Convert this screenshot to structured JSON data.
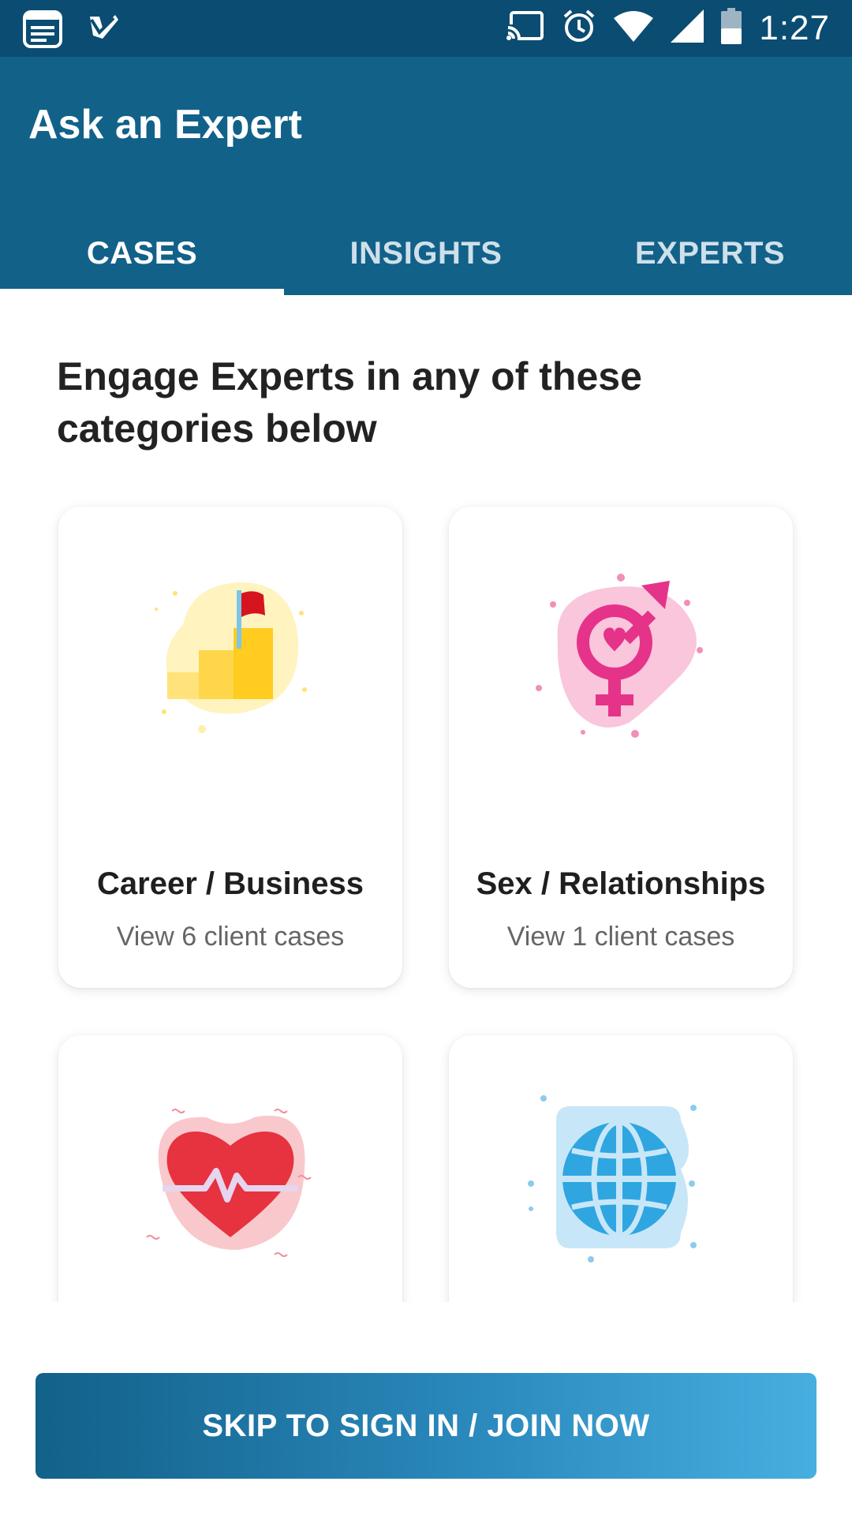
{
  "status_bar": {
    "time": "1:27",
    "icons": [
      "notes-app-icon",
      "task-check-icon",
      "cast-icon",
      "alarm-icon",
      "wifi-icon",
      "signal-icon",
      "battery-icon"
    ]
  },
  "app_bar": {
    "title": "Ask an Expert",
    "background": "#126189"
  },
  "tabs": [
    {
      "label": "CASES",
      "active": true
    },
    {
      "label": "INSIGHTS",
      "active": false
    },
    {
      "label": "EXPERTS",
      "active": false
    }
  ],
  "main": {
    "heading": "Engage Experts in any of these categories below",
    "categories": [
      {
        "title": "Career / Business",
        "subtitle": "View 6 client cases",
        "icon": "career-stairs-flag-icon"
      },
      {
        "title": "Sex / Relationships",
        "subtitle": "View 1 client cases",
        "icon": "gender-symbol-icon"
      },
      {
        "title": "",
        "subtitle": "",
        "icon": "heart-pulse-icon"
      },
      {
        "title": "",
        "subtitle": "",
        "icon": "globe-icon"
      }
    ]
  },
  "cta": {
    "label": "SKIP TO SIGN IN / JOIN NOW",
    "gradient_start": "#126189",
    "gradient_end": "#47aee0"
  }
}
